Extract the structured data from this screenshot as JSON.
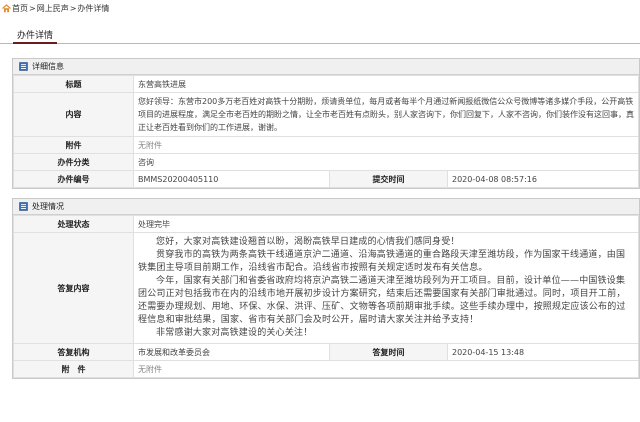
{
  "breadcrumb": {
    "home": "首页",
    "sep": ">",
    "mid": "网上民声",
    "current": "办件详情"
  },
  "tab": {
    "label": "办件详情"
  },
  "details": {
    "section_title": "详细信息",
    "title_label": "标题",
    "title_value": "东营高铁进展",
    "content_label": "内容",
    "content_value": "您好领导：东营市200多万老百姓对高铁十分期盼，烦请贵单位，每月或者每半个月通过新闻报纸微信公众号微博等诸多媒介手段，公开高铁项目的进展程度，满足全市老百姓的期盼之情，让全市老百姓有点盼头，别人家咨询下，你们回复下，人家不咨询，你们装作没有这回事，真正让老百姓看到你们的工作进展，谢谢。",
    "attachment_label": "附件",
    "attachment_value": "无附件",
    "category_label": "办件分类",
    "category_value": "咨询",
    "number_label": "办件编号",
    "number_value": "BMMS20200405110",
    "submit_time_label": "提交时间",
    "submit_time_value": "2020-04-08 08:57:16"
  },
  "processing": {
    "section_title": "处理情况",
    "status_label": "处理状态",
    "status_value": "处理完毕",
    "reply_label": "答复内容",
    "reply_paragraphs": [
      "您好，大家对高铁建设翘首以盼，渴盼高铁早日建成的心情我们感同身受！",
      "贯穿我市的高铁为两条高铁干线通道京沪二通道、沿海高铁通道的重合路段天津至潍坊段，作为国家干线通道，由国铁集团主导项目前期工作，沿线省市配合。沿线省市按照有关规定适时发布有关信息。",
      "今年，国家有关部门和省委省政府均将京沪高铁二通道天津至潍坊段列为开工项目。目前，设计单位——中国铁设集团公司正对包括我市在内的沿线市地开展初步设计方案研究，结束后还需要国家有关部门审批通过。同时，项目开工前，还需要办理规划、用地、环保、水保、洪评、压矿、文物等各项前期审批手续。这些手续办理中，按照规定应该公布的过程信息和审批结果，国家、省市有关部门会及时公开，届时请大家关注并给予支持！",
      "非常感谢大家对高铁建设的关心关注！"
    ],
    "org_label": "答复机构",
    "org_value": "市发展和改革委员会",
    "reply_time_label": "答复时间",
    "reply_time_value": "2020-04-15 13:48",
    "attachment_label": "附　件",
    "attachment_value": "无附件"
  }
}
